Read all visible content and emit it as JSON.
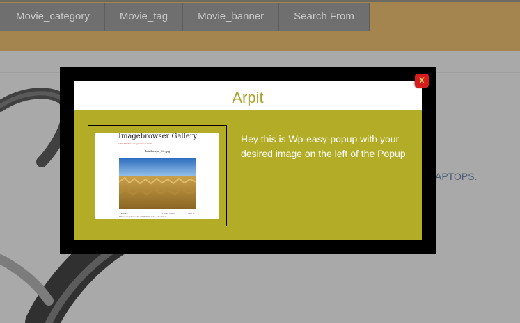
{
  "nav": {
    "items": [
      {
        "label": "Movie_category"
      },
      {
        "label": "Movie_tag"
      },
      {
        "label": "Movie_banner"
      },
      {
        "label": "Search From"
      }
    ]
  },
  "background": {
    "partial_text": "APTOPS."
  },
  "popup": {
    "title": "Arpit",
    "close_label": "X",
    "message": "Hey this is Wp-easy-popup with your desired image on the left of the Popup",
    "thumbnail": {
      "title": "Imagebrowser Gallery",
      "meta": "● 2013/04/07  ● imagebrowser  ● Edit",
      "caption": "landscape_00.jpg",
      "footer_back": "◄ Back",
      "footer_count": "Picture 1 of 6",
      "footer_next": "Next ►",
      "footer_text": "This is a caption in the WYSIWYG field; edited here"
    }
  },
  "colors": {
    "header_band": "#a4844f",
    "popup_body": "#b2ac27",
    "popup_title": "#a7a32a",
    "close_button": "#d71d1d"
  }
}
